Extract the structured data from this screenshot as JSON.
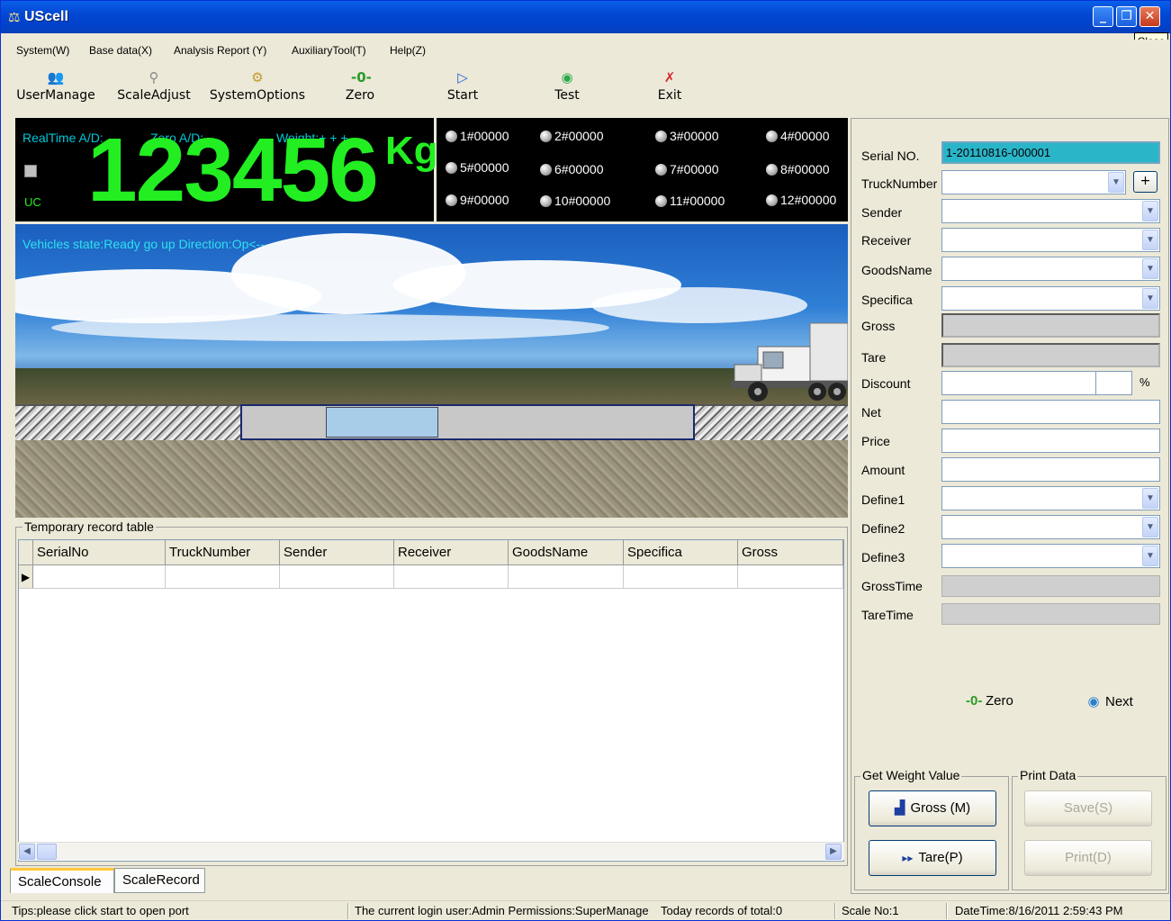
{
  "window": {
    "title": "UScell",
    "close_tooltip": "Close"
  },
  "menu": [
    "System(W)",
    "Base data(X)",
    "Analysis Report (Y)",
    "AuxiliaryTool(T)",
    "Help(Z)"
  ],
  "toolbar": {
    "user_manage": "UserManage",
    "scale_adjust": "ScaleAdjust",
    "system_options": "SystemOptions",
    "zero": "Zero",
    "start": "Start",
    "test": "Test",
    "exit": "Exit"
  },
  "display": {
    "realtime_ad": "RealTime A/D:",
    "zero_ad": "Zero A/D:",
    "weight": "Weight:+ + +",
    "value": "123456",
    "unit": "Kg",
    "uc": "UC"
  },
  "sensors": [
    "1#00000",
    "2#00000",
    "3#00000",
    "4#00000",
    "5#00000",
    "6#00000",
    "7#00000",
    "8#00000",
    "9#00000",
    "10#00000",
    "11#00000",
    "12#00000"
  ],
  "scene": {
    "vehicle_state": "Vehicles state:Ready go up  Direction:Op<--"
  },
  "temp_table": {
    "legend": "Temporary record table",
    "columns": [
      "SerialNo",
      "TruckNumber",
      "Sender",
      "Receiver",
      "GoodsName",
      "Specifica",
      "Gross"
    ]
  },
  "tabs": [
    "ScaleConsole",
    "ScaleRecord"
  ],
  "form": {
    "serial_no": {
      "label": "Serial NO.",
      "value": "1-20110816-000001"
    },
    "truck_number": {
      "label": "TruckNumber",
      "plus": "+"
    },
    "sender": {
      "label": "Sender"
    },
    "receiver": {
      "label": "Receiver"
    },
    "goods_name": {
      "label": "GoodsName"
    },
    "specifica": {
      "label": "Specifica"
    },
    "gross": {
      "label": "Gross"
    },
    "tare": {
      "label": "Tare"
    },
    "discount": {
      "label": "Discount",
      "unit": "%"
    },
    "net": {
      "label": "Net"
    },
    "price": {
      "label": "Price"
    },
    "amount": {
      "label": "Amount"
    },
    "define1": {
      "label": "Define1"
    },
    "define2": {
      "label": "Define2"
    },
    "define3": {
      "label": "Define3"
    },
    "gross_time": {
      "label": "GrossTime"
    },
    "tare_time": {
      "label": "TareTime"
    }
  },
  "actions": {
    "zero": "Zero",
    "next": "Next",
    "get_weight_legend": "Get Weight Value",
    "gross_btn": "Gross (M)",
    "tare_btn": "Tare(P)",
    "print_legend": "Print Data",
    "save_btn": "Save(S)",
    "print_btn": "Print(D)"
  },
  "status": {
    "tips": "Tips:please click start to open port",
    "login": "The current login user:Admin  Permissions:SuperManage",
    "records": "Today records of total:0",
    "scale_no": "Scale No:1",
    "datetime": "DateTime:8/16/2011 2:59:43 PM"
  },
  "colors": {
    "title_bar": "#0348d3",
    "display_green": "#22ee22",
    "display_cyan": "#00c8d8",
    "serial_bg": "#2bb5c9"
  }
}
